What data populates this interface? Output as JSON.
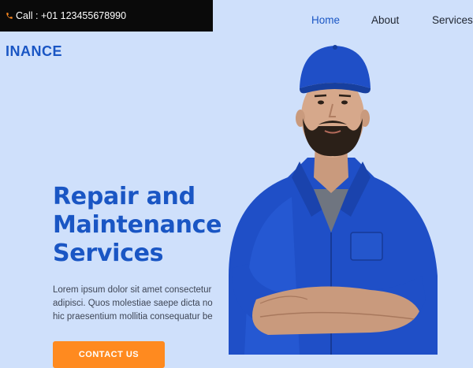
{
  "topbar": {
    "phone_text": "Call : +01 123455678990"
  },
  "nav": {
    "items": [
      {
        "label": "Home",
        "active": true
      },
      {
        "label": "About",
        "active": false
      },
      {
        "label": "Services",
        "active": false
      }
    ]
  },
  "brand": {
    "name": "INANCE"
  },
  "hero": {
    "title_lines": [
      "Repair and",
      "Maintenance",
      "Services"
    ],
    "text_lines": [
      "Lorem ipsum dolor sit amet consectetur adipisicing elit.",
      "adipisci. Quos molestiae saepe dicta nobis",
      "hic praesentium mollitia consequatur beatae"
    ],
    "cta_label": "CONTACT US"
  },
  "colors": {
    "accent": "#1a56c4",
    "background": "#cfe0fb",
    "cta": "#ff8a1f",
    "topbar": "#0a0a0a",
    "phone_icon": "#ff8a1f"
  },
  "icons": {
    "phone": "phone-icon"
  }
}
